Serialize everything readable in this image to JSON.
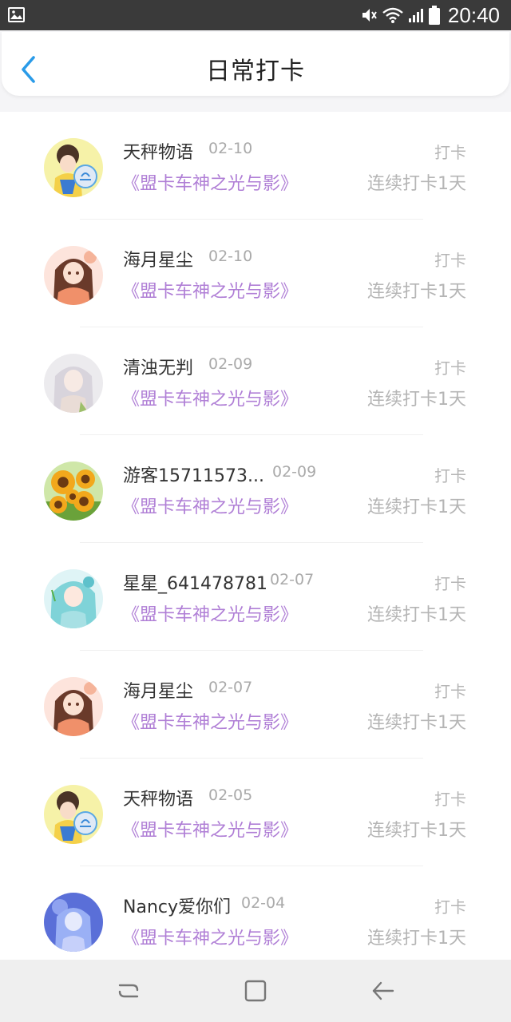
{
  "status_bar": {
    "time": "20:40",
    "icons": [
      "image-icon",
      "mute-icon",
      "wifi-icon",
      "signal-icon",
      "battery-icon"
    ]
  },
  "header": {
    "title": "日常打卡",
    "back_icon": "chevron-left-icon"
  },
  "colors": {
    "accent": "#2a9be8",
    "book_title": "#b07fd6",
    "muted": "#b5b5b5"
  },
  "entries": [
    {
      "name": "天秤物语",
      "date": "02-10",
      "book": "《盟卡车神之光与影》",
      "action": "打卡",
      "streak": "连续打卡1天",
      "avatar": "anime-avatar-libra"
    },
    {
      "name": "海月星尘",
      "date": "02-10",
      "book": "《盟卡车神之光与影》",
      "action": "打卡",
      "streak": "连续打卡1天",
      "avatar": "anime-avatar-girl-brown"
    },
    {
      "name": "清浊无判",
      "date": "02-09",
      "book": "《盟卡车神之光与影》",
      "action": "打卡",
      "streak": "连续打卡1天",
      "avatar": "anime-avatar-silver-hair"
    },
    {
      "name": "游客15711573...",
      "date": "02-09",
      "book": "《盟卡车神之光与影》",
      "action": "打卡",
      "streak": "连续打卡1天",
      "avatar": "sunflower-avatar"
    },
    {
      "name": "星星_641478781",
      "date": "02-07",
      "book": "《盟卡车神之光与影》",
      "action": "打卡",
      "streak": "连续打卡1天",
      "avatar": "anime-avatar-teal-hair"
    },
    {
      "name": "海月星尘",
      "date": "02-07",
      "book": "《盟卡车神之光与影》",
      "action": "打卡",
      "streak": "连续打卡1天",
      "avatar": "anime-avatar-girl-brown"
    },
    {
      "name": "天秤物语",
      "date": "02-05",
      "book": "《盟卡车神之光与影》",
      "action": "打卡",
      "streak": "连续打卡1天",
      "avatar": "anime-avatar-libra"
    },
    {
      "name": "Nancy爱你们",
      "date": "02-04",
      "book": "《盟卡车神之光与影》",
      "action": "打卡",
      "streak": "连续打卡1天",
      "avatar": "anime-avatar-blue"
    }
  ],
  "nav_bar": {
    "buttons": [
      "recent-apps-icon",
      "home-icon",
      "back-icon"
    ]
  }
}
